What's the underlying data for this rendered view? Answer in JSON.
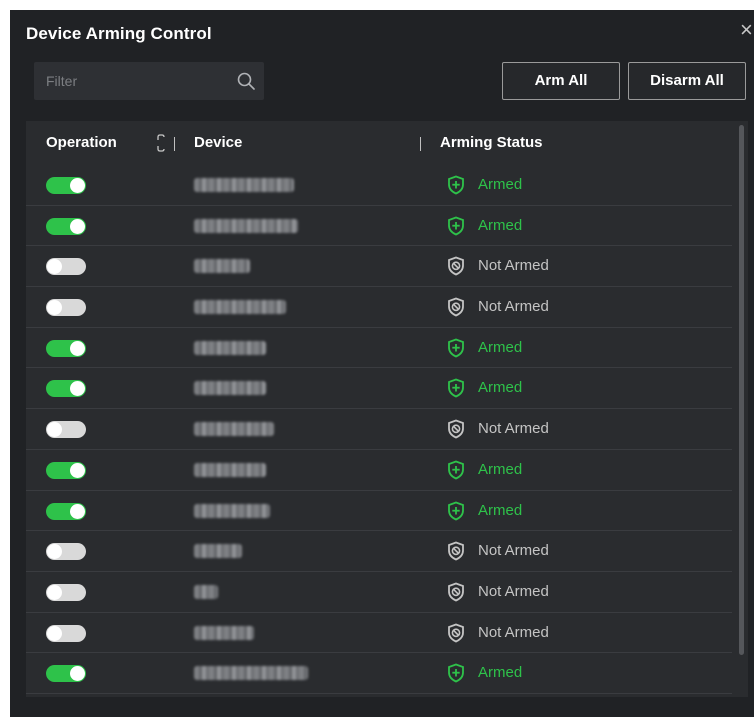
{
  "dialog": {
    "title": "Device Arming Control",
    "close_glyph": "×"
  },
  "toolbar": {
    "filter_placeholder": "Filter",
    "filter_value": "",
    "arm_all_label": "Arm All",
    "disarm_all_label": "Disarm All"
  },
  "table": {
    "headers": {
      "operation": "Operation",
      "device": "Device",
      "arming_status": "Arming Status"
    },
    "rows": [
      {
        "enabled": true,
        "status": "Armed",
        "device_name_blurred": true
      },
      {
        "enabled": true,
        "status": "Armed",
        "device_name_blurred": true
      },
      {
        "enabled": false,
        "status": "Not Armed",
        "device_name_blurred": true
      },
      {
        "enabled": false,
        "status": "Not Armed",
        "device_name_blurred": true
      },
      {
        "enabled": true,
        "status": "Armed",
        "device_name_blurred": true
      },
      {
        "enabled": true,
        "status": "Armed",
        "device_name_blurred": true
      },
      {
        "enabled": false,
        "status": "Not Armed",
        "device_name_blurred": true
      },
      {
        "enabled": true,
        "status": "Armed",
        "device_name_blurred": true
      },
      {
        "enabled": true,
        "status": "Armed",
        "device_name_blurred": true
      },
      {
        "enabled": false,
        "status": "Not Armed",
        "device_name_blurred": true
      },
      {
        "enabled": false,
        "status": "Not Armed",
        "device_name_blurred": true
      },
      {
        "enabled": false,
        "status": "Not Armed",
        "device_name_blurred": true
      },
      {
        "enabled": true,
        "status": "Armed",
        "device_name_blurred": true
      }
    ]
  },
  "icons": {
    "search": "search-icon",
    "sort": "sort-icon",
    "armed": "shield-plus-icon",
    "not_armed": "shield-disabled-icon",
    "close": "close-icon"
  },
  "colors": {
    "dialog_bg": "#202225",
    "table_bg": "#2a2c2f",
    "toggle_on": "#2ec24a",
    "toggle_off": "#d9d9d9",
    "armed_text": "#2ec24a",
    "not_armed_text": "#c4c4c4"
  }
}
